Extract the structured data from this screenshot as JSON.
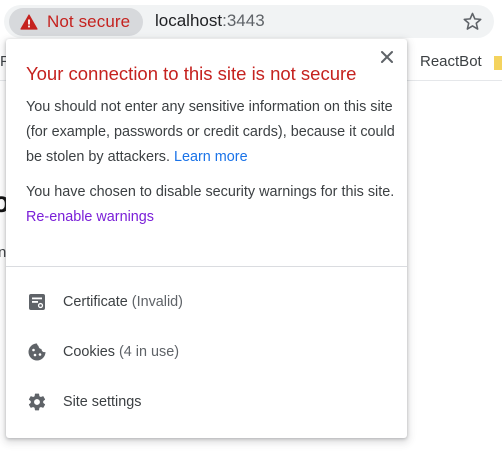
{
  "omnibox": {
    "security_chip_label": "Not secure",
    "url_host": "localhost",
    "url_port": ":3443",
    "star_icon": "bookmark-star-icon"
  },
  "background_page": {
    "bookmark_label": "ReactBot"
  },
  "popup": {
    "title": "Your connection to this site is not secure",
    "paragraph1_text": "You should not enter any sensitive information on this site (for example, passwords or credit cards), because it could be stolen by attackers. ",
    "paragraph1_link": "Learn more",
    "paragraph2_text": "You have chosen to disable security warnings for this site. ",
    "paragraph2_link": "Re-enable warnings",
    "items": [
      {
        "label": "Certificate",
        "detail": "(Invalid)",
        "icon": "certificate-icon"
      },
      {
        "label": "Cookies",
        "detail": "(4 in use)",
        "icon": "cookie-icon"
      },
      {
        "label": "Site settings",
        "detail": "",
        "icon": "gear-icon"
      }
    ]
  },
  "colors": {
    "warning_red": "#c5221f",
    "link_blue": "#1a73e8",
    "link_visited": "#7a1fd8"
  }
}
